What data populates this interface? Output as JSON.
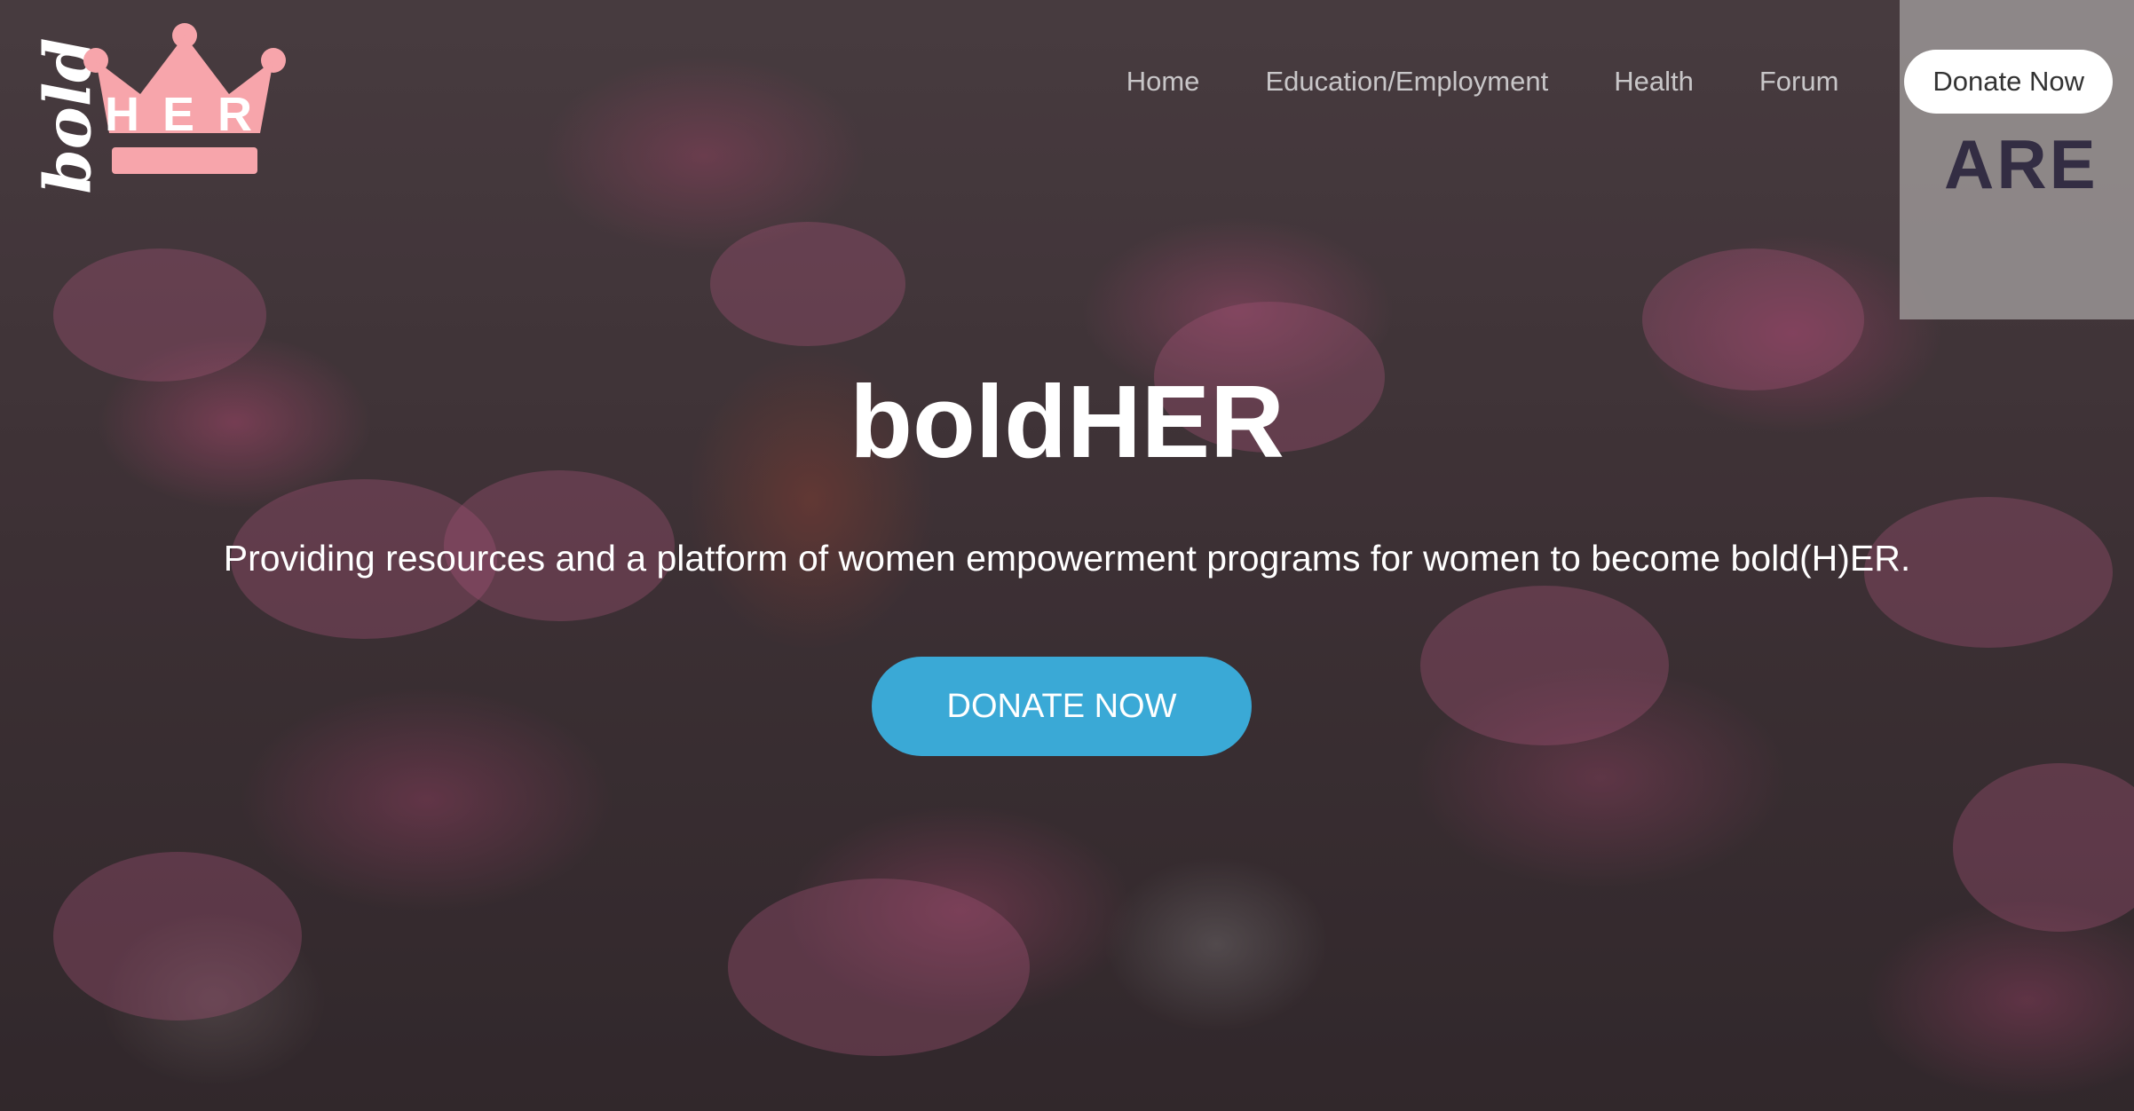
{
  "brand": {
    "logo_script": "bold",
    "logo_letters": "HER",
    "crown_color": "#f7a5ab"
  },
  "nav": {
    "items": [
      {
        "label": "Home"
      },
      {
        "label": "Education/Employment"
      },
      {
        "label": "Health"
      },
      {
        "label": "Forum"
      }
    ],
    "donate_label": "Donate Now"
  },
  "hero": {
    "title": "boldHER",
    "subtitle": "Providing resources and a platform of women empowerment programs for women to become bold(H)ER.",
    "cta_label": "DONATE NOW",
    "cta_color": "#3aa9d6",
    "sign_text": "ARE"
  }
}
